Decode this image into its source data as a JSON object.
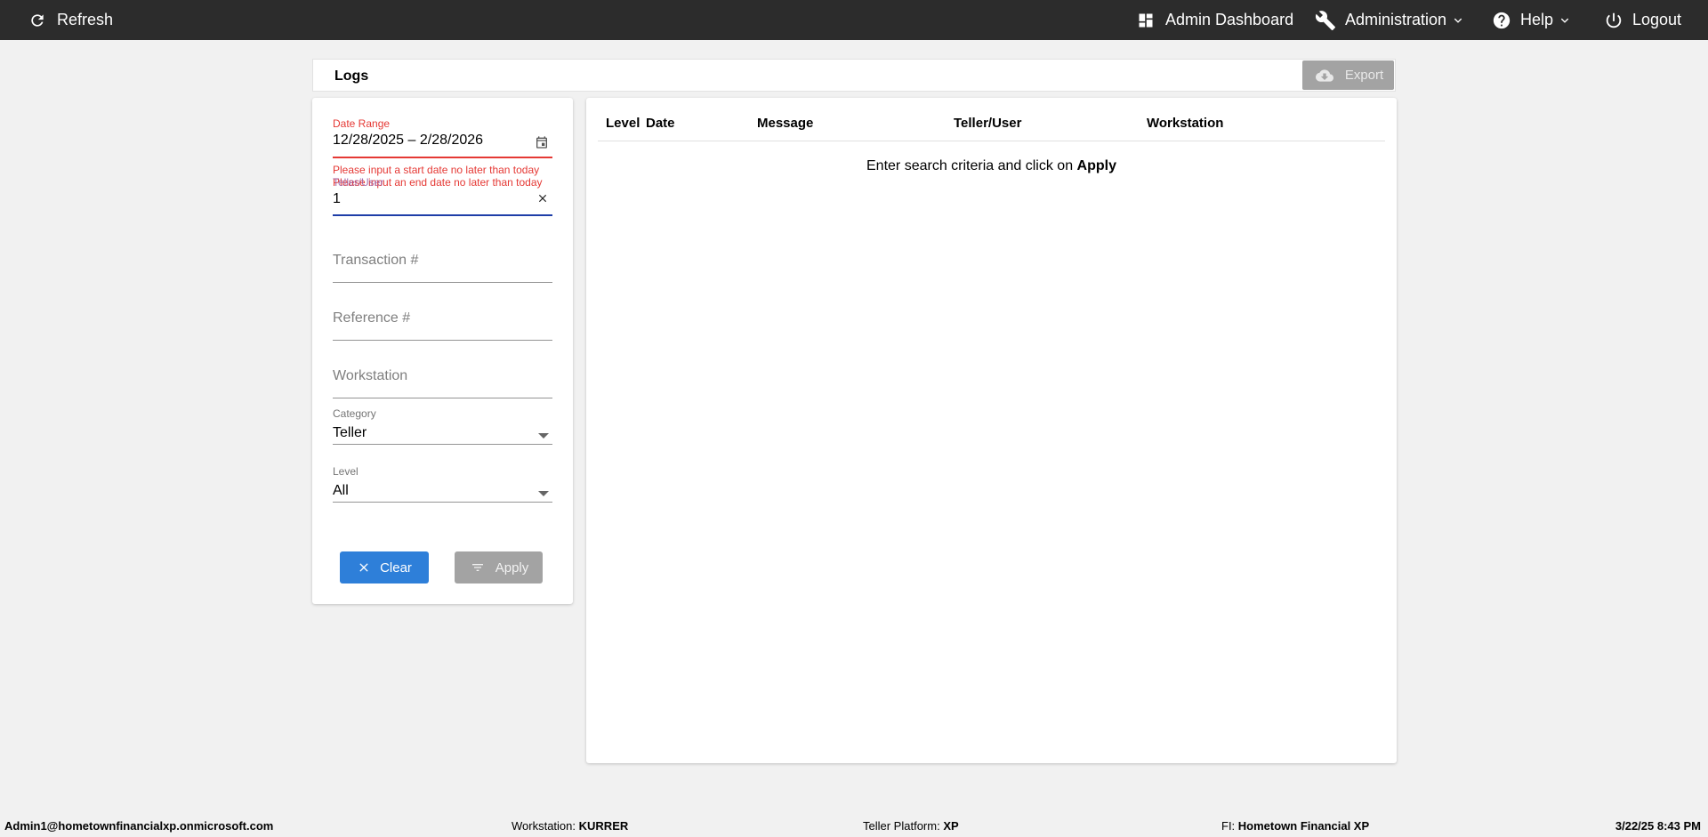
{
  "topbar": {
    "refresh_label": "Refresh",
    "admin_dashboard_label": "Admin Dashboard",
    "administration_label": "Administration",
    "help_label": "Help",
    "logout_label": "Logout"
  },
  "logs": {
    "title": "Logs",
    "export_label": "Export"
  },
  "filters": {
    "date_range_label": "Date Range",
    "date_range_value": "12/28/2025 – 2/28/2026",
    "start_date_error": "Please input a start date no later than today",
    "end_date_error": "Please input an end date no later than today",
    "teller_user_label": "Teller/User",
    "teller_user_value": "1",
    "transaction_placeholder": "Transaction #",
    "reference_placeholder": "Reference #",
    "workstation_placeholder": "Workstation",
    "category_label": "Category",
    "category_value": "Teller",
    "level_label": "Level",
    "level_value": "All",
    "clear_label": "Clear",
    "apply_label": "Apply"
  },
  "results": {
    "columns": [
      "Level",
      "Date",
      "Message",
      "Teller/User",
      "Workstation"
    ],
    "empty_prefix": "Enter search criteria and click on ",
    "empty_action": "Apply"
  },
  "footer": {
    "user": "Admin1@hometownfinancialxp.onmicrosoft.com",
    "workstation_label": "Workstation:",
    "workstation_value": "KURRER",
    "platform_label": "Teller Platform:",
    "platform_value": "XP",
    "fi_label": "FI:",
    "fi_value": "Hometown Financial XP",
    "datetime": "3/22/25 8:43 PM"
  },
  "colors": {
    "topbar": "#2c2c2c",
    "clear_button": "#2e7fd9",
    "disabled_button": "#a3a3a3",
    "error": "#e53935",
    "focus": "#1e3ea8"
  }
}
